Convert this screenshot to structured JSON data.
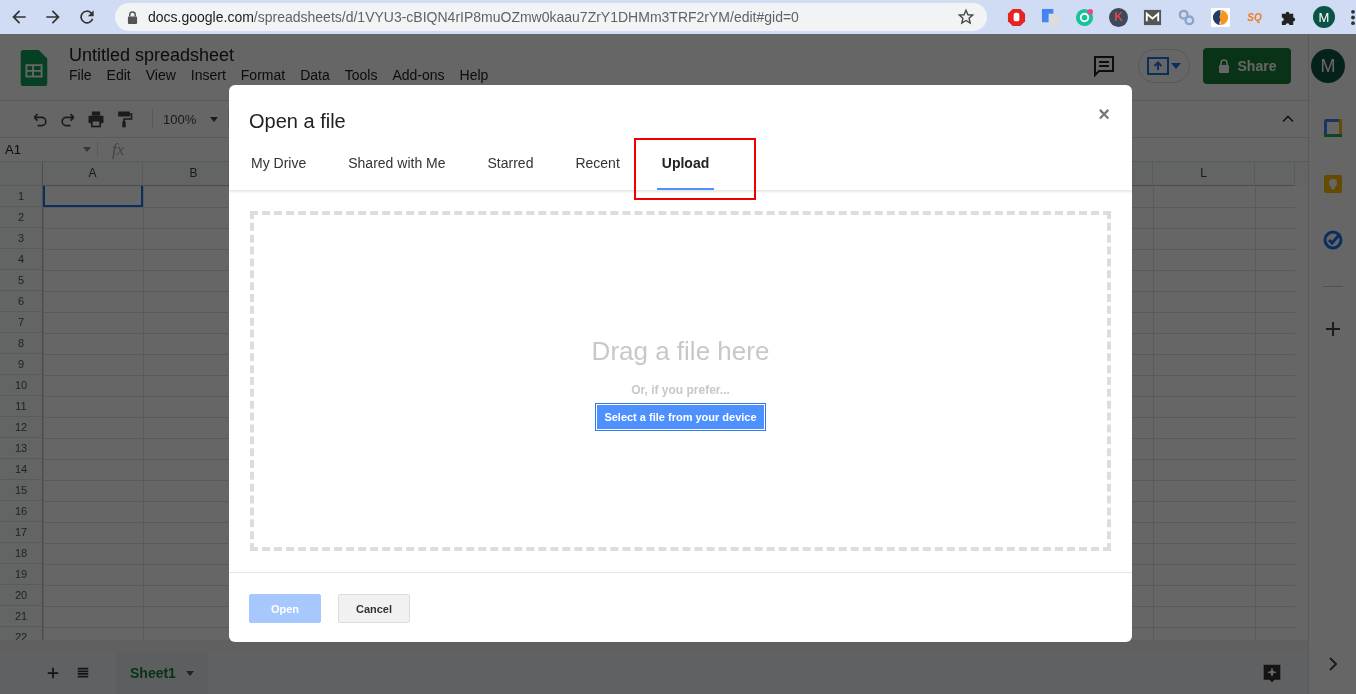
{
  "browser": {
    "url_host": "docs.google.com",
    "url_path": "/spreadsheets/d/1VYU3-cBIQN4rIP8muOZmw0kaau7ZrY1DHMm3TRF2rYM/edit#gid=0",
    "extensions": [
      {
        "kind": "stop"
      },
      {
        "kind": "translate"
      },
      {
        "kind": "grammar"
      },
      {
        "kind": "letter",
        "label": "K"
      },
      {
        "kind": "mail"
      },
      {
        "kind": "link"
      },
      {
        "kind": "swirl"
      },
      {
        "kind": "badge",
        "label": "SQ"
      },
      {
        "kind": "puzzle"
      }
    ],
    "avatar": "M"
  },
  "doc": {
    "title": "Untitled spreadsheet",
    "menu": [
      "File",
      "Edit",
      "View",
      "Insert",
      "Format",
      "Data",
      "Tools",
      "Add-ons",
      "Help"
    ],
    "share": "Share",
    "avatar": "M"
  },
  "toolbar": {
    "zoom": "100%"
  },
  "formula_bar": {
    "cell_ref": "A1",
    "fx": "fx"
  },
  "grid": {
    "columns": [
      "A",
      "B",
      "L"
    ],
    "rows": [
      "1",
      "2",
      "3",
      "4",
      "5",
      "6",
      "7",
      "8",
      "9",
      "10",
      "11",
      "12",
      "13",
      "14",
      "15",
      "16",
      "17",
      "18",
      "19",
      "20",
      "21",
      "22"
    ]
  },
  "sheets": [
    {
      "label": "Sheet1",
      "selected": true
    }
  ],
  "dialog": {
    "title": "Open a file",
    "close": "×",
    "tabs": [
      {
        "label": "My Drive",
        "selected": false,
        "highlighted": false
      },
      {
        "label": "Shared with Me",
        "selected": false,
        "highlighted": false
      },
      {
        "label": "Starred",
        "selected": false,
        "highlighted": false
      },
      {
        "label": "Recent",
        "selected": false,
        "highlighted": false
      },
      {
        "label": "Upload",
        "selected": true,
        "highlighted": true
      }
    ],
    "drop_text": "Drag a file here",
    "alt_text": "Or, if you prefer...",
    "select_button": "Select a file from your device",
    "buttons": [
      {
        "label": "Open",
        "kind": "primary",
        "disabled": true
      },
      {
        "label": "Cancel",
        "kind": "secondary",
        "disabled": false
      }
    ]
  }
}
